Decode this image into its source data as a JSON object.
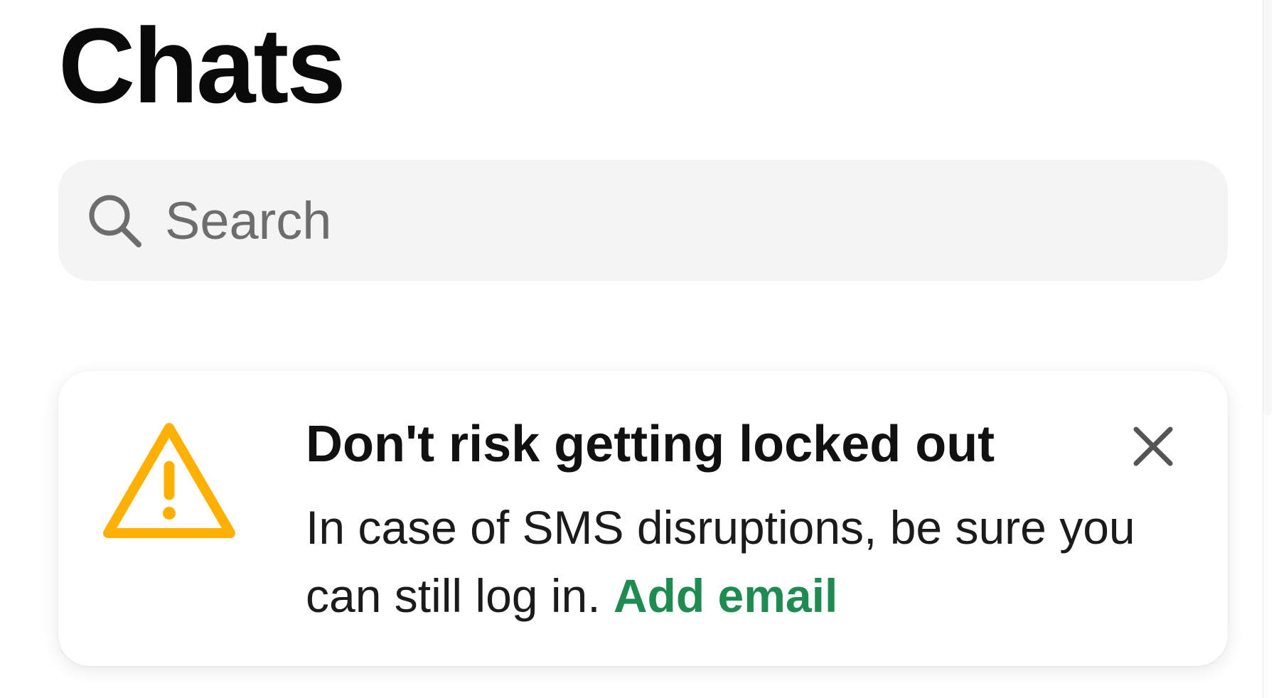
{
  "header": {
    "title": "Chats"
  },
  "search": {
    "placeholder": "Search",
    "value": "",
    "icon": "search-icon"
  },
  "banner": {
    "icon": "warning-icon",
    "title": "Don't risk getting locked out",
    "message": "In case of SMS disruptions, be sure you can still log in.",
    "link_label": "Add email",
    "close_icon": "close-icon"
  },
  "colors": {
    "warning": "#FFB000",
    "link": "#1E8C51",
    "search_background": "#F4F4F4",
    "placeholder_text": "#6D6D6D",
    "title_text": "#0A0A0A"
  }
}
